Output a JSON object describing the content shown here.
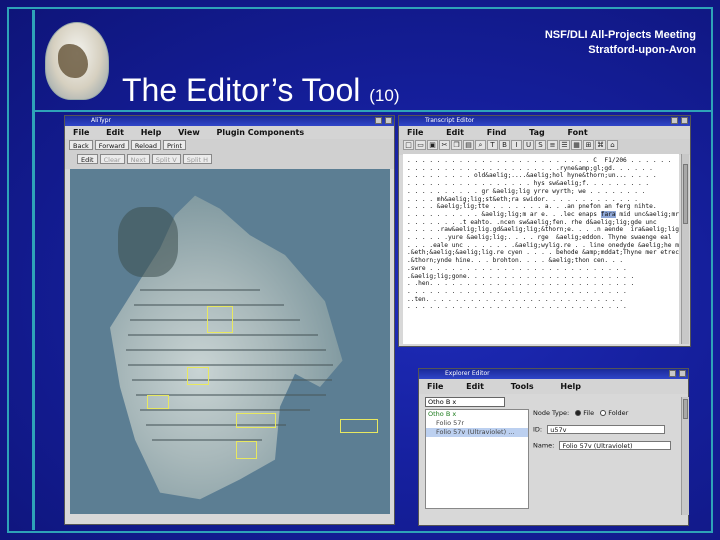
{
  "slide": {
    "meeting_line1": "NSF/DLI All-Projects Meeting",
    "meeting_line2": "Stratford-upon-Avon",
    "title": "The Editor’s Tool",
    "title_number": "(10)",
    "accent_color": "#2ea3b8",
    "background_color": "#151f9c"
  },
  "image_window": {
    "title": "AliTypr",
    "menu": [
      "File",
      "Edit",
      "Help",
      "View",
      "Plugin Components"
    ],
    "toolbar1": [
      "Back",
      "Forward",
      "Reload",
      "Print"
    ],
    "toolbar2": [
      "Edit",
      "Clear",
      "Next",
      "Split V",
      "Split H"
    ]
  },
  "transcript_window": {
    "title": "Transcript Editor",
    "menu": [
      "File",
      "Edit",
      "Find",
      "Tag",
      "Font"
    ],
    "lines": [
      ". . . . . . . . . . . . . . . . . . . . . . . . . C  F1/206 . . . . . .",
      ". . . . . . . . . . . . . . . . . . . . .ryne&amp;gl;gd. . . . . .",
      ". . . . . . . . . old&aelig;....&aelig;hol hyne&thorn;un... . . . .",
      ". . . . . . . . . . . . . . . . . hys sw&aelig;f. . . . . . . . .",
      ". . . . . . . . . . gr &aelig;lig yrre wyrth; we . . . . . . . .",
      ". . . . mh&aelig;lig;st&eth;ra swidor. . . . . . . . . . . . .",
      ". . . . &aelig;lig;tte . . . . . . . a. . .an pnefon an ferg nihte.",
      ". . . . . . . . . . &aelig;lig;m ar e. . .lec enaps fara mid unc&aelig;mrdat;",
      ". . . . . . . .t eahto. .ncen sw&aelig;fen. rhe d&aelig;lig;gde unc",
      ". . . . .raw&aelig;lig.gd&aelig;lig;&thorn;e. . . .n aende  ira&aelig;lig.swfl geoe.",
      ". . . . . .yure &aelig;lig;. . . . rge  &aelig;eddon. Thyne swaenge eal",
      ". . . .eale unc . . . . . . .&aelig;wylig.re . . line onedyde &aelig;he mynge",
      ".&eth;&aelig;&aelig;lig.re cyen . . . . behode &amp;mddat;Thyne mer etrecene",
      ".&thorn;ynde hine. . . brohton. . . . &aelig;thon cen. . .",
      ".swre . . . . . . . . . . . . . . . . . . . . . . . . . . .",
      ".&aelig;lig;gone. . . . . . . . . . . . . . . . . . . . . . .",
      ". .hen. . . . . . . . . . . . . . . . . . . . . . . . . . . .",
      ". . . . . . . . . . . . . . . . . . . . . . . . . . . . . .",
      "..ten. . . . . . . . . . . . . . . . . . . . . . . . . . .",
      ". . . . . . . . . . . . . . . . . . . . . . . . . . . . . ."
    ],
    "highlight_line": 7,
    "highlight_word": "fara"
  },
  "explorer_window": {
    "title": "Explorer Editor",
    "menu": [
      "File",
      "Edit",
      "Tools",
      "Help"
    ],
    "tree_header": "Otho B x",
    "tree_items": [
      "Otho B x",
      "Folio 57r",
      "Folio 57v (Ultraviolet) ..."
    ],
    "node_type_label": "Node Type:",
    "option_file": "File",
    "option_folder": "Folder",
    "id_label": "ID:",
    "id_value": "u57v",
    "name_label": "Name:",
    "name_value": "Folio 57v (Ultraviolet)"
  }
}
